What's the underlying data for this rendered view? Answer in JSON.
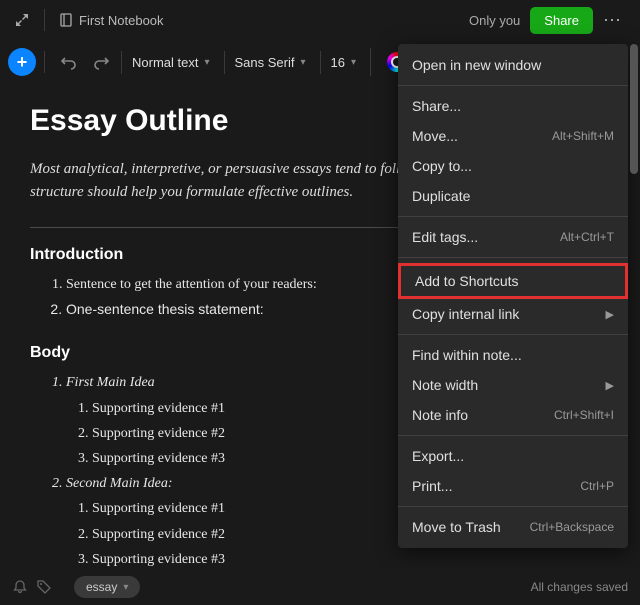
{
  "header": {
    "notebook": "First Notebook",
    "only_you": "Only you",
    "share": "Share"
  },
  "toolbar": {
    "style": "Normal text",
    "font": "Sans Serif",
    "size": "16"
  },
  "doc": {
    "title": "Essay Outline",
    "intro": "Most analytical, interpretive, or persuasive essays tend to follow the same basic pattern. This structure should help you formulate effective outlines.",
    "s1": {
      "head": "Introduction",
      "i1": "Sentence to get the attention of your readers:",
      "i2": "One-sentence thesis statement:"
    },
    "s2": {
      "head": "Body",
      "m1": "First Main Idea",
      "m2": "Second Main Idea:",
      "e1": "Supporting evidence #1",
      "e2": "Supporting evidence #2",
      "e3": "Supporting evidence #3"
    }
  },
  "menu": {
    "open": "Open in new window",
    "share": "Share...",
    "move": "Move...",
    "move_kb": "Alt+Shift+M",
    "copy": "Copy to...",
    "dup": "Duplicate",
    "tags": "Edit tags...",
    "tags_kb": "Alt+Ctrl+T",
    "shortcut": "Add to Shortcuts",
    "copylink": "Copy internal link",
    "find": "Find within note...",
    "width": "Note width",
    "info": "Note info",
    "info_kb": "Ctrl+Shift+I",
    "export": "Export...",
    "print": "Print...",
    "print_kb": "Ctrl+P",
    "trash": "Move to Trash",
    "trash_kb": "Ctrl+Backspace"
  },
  "footer": {
    "tag": "essay",
    "status": "All changes saved"
  }
}
